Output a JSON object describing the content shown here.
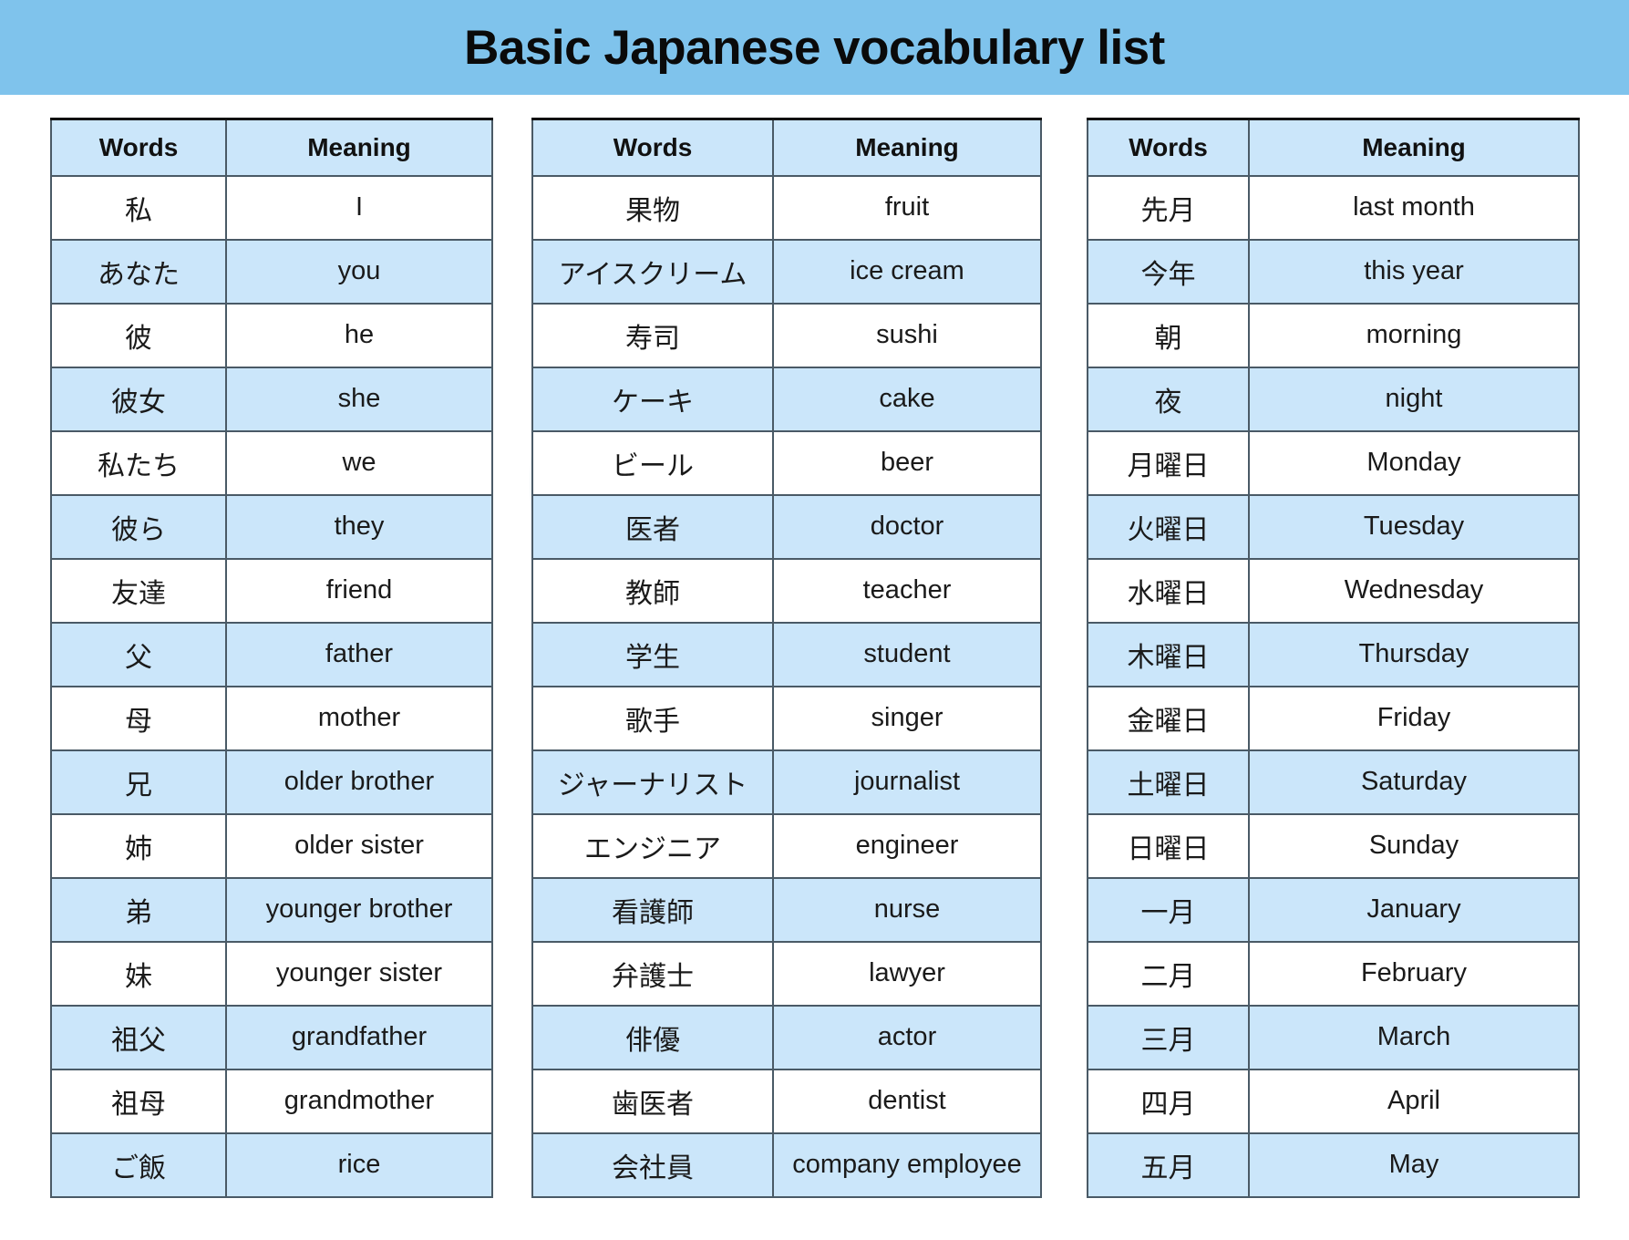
{
  "title": "Basic Japanese vocabulary list",
  "colors": {
    "banner": "#7fc3ec",
    "header_cell": "#cbe6fa",
    "alt_row": "#cbe6fa",
    "row": "#ffffff",
    "border": "#4a5a66",
    "text": "#1a1a1a"
  },
  "columns": {
    "words": "Words",
    "meaning": "Meaning"
  },
  "tables": [
    {
      "id": "table-1",
      "headers": [
        "Words",
        "Meaning"
      ],
      "rows": [
        [
          "私",
          "I"
        ],
        [
          "あなた",
          "you"
        ],
        [
          "彼",
          "he"
        ],
        [
          "彼女",
          "she"
        ],
        [
          "私たち",
          "we"
        ],
        [
          "彼ら",
          "they"
        ],
        [
          "友達",
          "friend"
        ],
        [
          "父",
          "father"
        ],
        [
          "母",
          "mother"
        ],
        [
          "兄",
          "older brother"
        ],
        [
          "姉",
          "older sister"
        ],
        [
          "弟",
          "younger brother"
        ],
        [
          "妹",
          "younger sister"
        ],
        [
          "祖父",
          "grandfather"
        ],
        [
          "祖母",
          "grandmother"
        ],
        [
          "ご飯",
          "rice"
        ]
      ]
    },
    {
      "id": "table-2",
      "headers": [
        "Words",
        "Meaning"
      ],
      "rows": [
        [
          "果物",
          "fruit"
        ],
        [
          "アイスクリーム",
          "ice cream"
        ],
        [
          "寿司",
          "sushi"
        ],
        [
          "ケーキ",
          "cake"
        ],
        [
          "ビール",
          "beer"
        ],
        [
          "医者",
          "doctor"
        ],
        [
          "教師",
          "teacher"
        ],
        [
          "学生",
          "student"
        ],
        [
          "歌手",
          "singer"
        ],
        [
          "ジャーナリスト",
          "journalist"
        ],
        [
          "エンジニア",
          "engineer"
        ],
        [
          "看護師",
          "nurse"
        ],
        [
          "弁護士",
          "lawyer"
        ],
        [
          "俳優",
          "actor"
        ],
        [
          "歯医者",
          "dentist"
        ],
        [
          "会社員",
          "company employee"
        ]
      ]
    },
    {
      "id": "table-3",
      "headers": [
        "Words",
        "Meaning"
      ],
      "rows": [
        [
          "先月",
          "last month"
        ],
        [
          "今年",
          "this year"
        ],
        [
          "朝",
          "morning"
        ],
        [
          "夜",
          "night"
        ],
        [
          "月曜日",
          "Monday"
        ],
        [
          "火曜日",
          "Tuesday"
        ],
        [
          "水曜日",
          "Wednesday"
        ],
        [
          "木曜日",
          "Thursday"
        ],
        [
          "金曜日",
          "Friday"
        ],
        [
          "土曜日",
          "Saturday"
        ],
        [
          "日曜日",
          "Sunday"
        ],
        [
          "一月",
          "January"
        ],
        [
          "二月",
          "February"
        ],
        [
          "三月",
          "March"
        ],
        [
          "四月",
          "April"
        ],
        [
          "五月",
          "May"
        ]
      ]
    }
  ]
}
